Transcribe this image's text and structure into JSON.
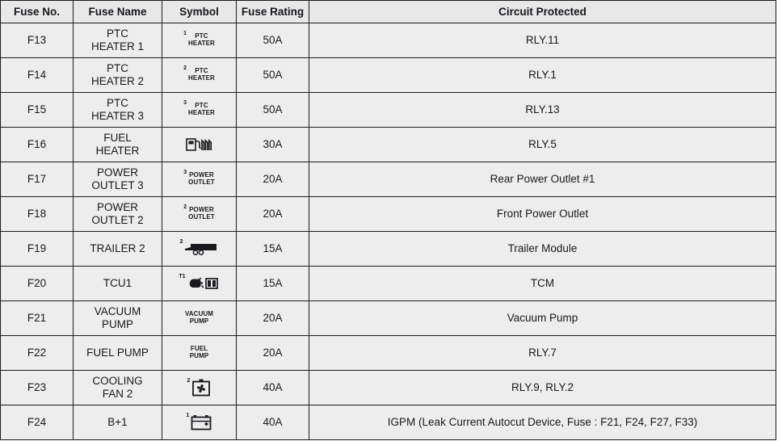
{
  "table": {
    "headers": [
      "Fuse No.",
      "Fuse Name",
      "Symbol",
      "Fuse Rating",
      "Circuit Protected"
    ],
    "rows": [
      {
        "fuse_no": "F13",
        "name_line1": "PTC",
        "name_line2": "HEATER 1",
        "symbol": {
          "kind": "text",
          "sup": "1",
          "line1": "PTC",
          "line2": "HEATER",
          "icon": "ptc-heater-icon"
        },
        "rating": "50A",
        "circuit": "RLY.11"
      },
      {
        "fuse_no": "F14",
        "name_line1": "PTC",
        "name_line2": "HEATER 2",
        "symbol": {
          "kind": "text",
          "sup": "2",
          "line1": "PTC",
          "line2": "HEATER",
          "icon": "ptc-heater-icon"
        },
        "rating": "50A",
        "circuit": "RLY.1"
      },
      {
        "fuse_no": "F15",
        "name_line1": "PTC",
        "name_line2": "HEATER 3",
        "symbol": {
          "kind": "text",
          "sup": "3",
          "line1": "PTC",
          "line2": "HEATER",
          "icon": "ptc-heater-icon"
        },
        "rating": "50A",
        "circuit": "RLY.13"
      },
      {
        "fuse_no": "F16",
        "name_line1": "FUEL",
        "name_line2": "HEATER",
        "symbol": {
          "kind": "icon",
          "sup": "",
          "line1": "",
          "line2": "",
          "icon": "fuel-heater-icon"
        },
        "rating": "30A",
        "circuit": "RLY.5"
      },
      {
        "fuse_no": "F17",
        "name_line1": "POWER",
        "name_line2": "OUTLET 3",
        "symbol": {
          "kind": "text",
          "sup": "3",
          "line1": "POWER",
          "line2": "OUTLET",
          "icon": "power-outlet-icon"
        },
        "rating": "20A",
        "circuit": "Rear Power Outlet #1"
      },
      {
        "fuse_no": "F18",
        "name_line1": "POWER",
        "name_line2": "OUTLET 2",
        "symbol": {
          "kind": "text",
          "sup": "2",
          "line1": "POWER",
          "line2": "OUTLET",
          "icon": "power-outlet-icon"
        },
        "rating": "20A",
        "circuit": "Front Power Outlet"
      },
      {
        "fuse_no": "F19",
        "name_line1": "TRAILER 2",
        "name_line2": "",
        "symbol": {
          "kind": "icon",
          "sup": "2",
          "line1": "",
          "line2": "",
          "icon": "trailer-icon"
        },
        "rating": "15A",
        "circuit": "Trailer Module"
      },
      {
        "fuse_no": "F20",
        "name_line1": "TCU1",
        "name_line2": "",
        "symbol": {
          "kind": "icon",
          "sup": "T1",
          "line1": "",
          "line2": "",
          "icon": "transmission-control-icon"
        },
        "rating": "15A",
        "circuit": "TCM"
      },
      {
        "fuse_no": "F21",
        "name_line1": "VACUUM",
        "name_line2": "PUMP",
        "symbol": {
          "kind": "text",
          "sup": "",
          "line1": "VACUUM",
          "line2": "PUMP",
          "icon": "vacuum-pump-icon"
        },
        "rating": "20A",
        "circuit": "Vacuum Pump"
      },
      {
        "fuse_no": "F22",
        "name_line1": "FUEL PUMP",
        "name_line2": "",
        "symbol": {
          "kind": "text",
          "sup": "",
          "line1": "FUEL",
          "line2": "PUMP",
          "icon": "fuel-pump-icon"
        },
        "rating": "20A",
        "circuit": "RLY.7"
      },
      {
        "fuse_no": "F23",
        "name_line1": "COOLING",
        "name_line2": "FAN 2",
        "symbol": {
          "kind": "icon",
          "sup": "2",
          "line1": "",
          "line2": "",
          "icon": "cooling-fan-icon"
        },
        "rating": "40A",
        "circuit": "RLY.9, RLY.2"
      },
      {
        "fuse_no": "F24",
        "name_line1": "B+1",
        "name_line2": "",
        "symbol": {
          "kind": "icon",
          "sup": "1",
          "line1": "",
          "line2": "",
          "icon": "battery-icon"
        },
        "rating": "40A",
        "circuit": "IGPM (Leak Current Autocut Device, Fuse : F21, F24, F27, F33)"
      }
    ]
  },
  "colors": {
    "cell_background": "#ededed",
    "header_background": "#e8e8e8",
    "border": "#1c1c1c",
    "text": "#19191e",
    "page_background": "#ffffff"
  }
}
